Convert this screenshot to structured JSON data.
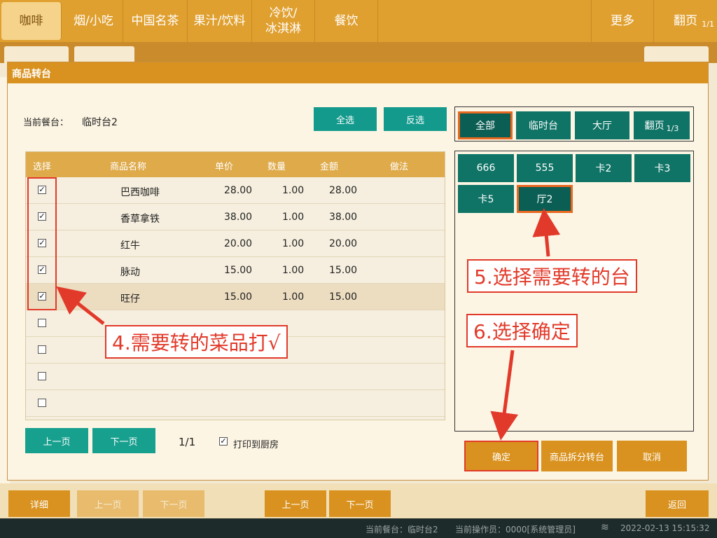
{
  "topbar": {
    "categories": [
      "咖啡",
      "烟/小吃",
      "中国名茶",
      "果汁/饮料",
      "冷饮/\n冰淇淋",
      "餐饮"
    ],
    "more": "更多",
    "page_label": "翻页",
    "page_num": "1/1"
  },
  "dialog": {
    "title": "商品转台",
    "current_table_label": "当前餐台：",
    "current_table_value": "临时台2",
    "select_all": "全选",
    "invert_select": "反选",
    "table": {
      "headers": [
        "选择",
        "商品名称",
        "单价",
        "数量",
        "金额",
        "做法"
      ],
      "rows": [
        {
          "checked": true,
          "name": "巴西咖啡",
          "price": "28.00",
          "qty": "1.00",
          "amount": "28.00",
          "method": ""
        },
        {
          "checked": true,
          "name": "香草拿铁",
          "price": "38.00",
          "qty": "1.00",
          "amount": "38.00",
          "method": ""
        },
        {
          "checked": true,
          "name": "红牛",
          "price": "20.00",
          "qty": "1.00",
          "amount": "20.00",
          "method": ""
        },
        {
          "checked": true,
          "name": "脉动",
          "price": "15.00",
          "qty": "1.00",
          "amount": "15.00",
          "method": ""
        },
        {
          "checked": true,
          "name": "旺仔",
          "price": "15.00",
          "qty": "1.00",
          "amount": "15.00",
          "method": ""
        },
        {
          "checked": false,
          "name": "",
          "price": "",
          "qty": "",
          "amount": "",
          "method": ""
        },
        {
          "checked": false,
          "name": "",
          "price": "",
          "qty": "",
          "amount": "",
          "method": ""
        },
        {
          "checked": false,
          "name": "",
          "price": "",
          "qty": "",
          "amount": "",
          "method": ""
        },
        {
          "checked": false,
          "name": "",
          "price": "",
          "qty": "",
          "amount": "",
          "method": ""
        }
      ]
    },
    "prev_page": "上一页",
    "next_page": "下一页",
    "page_indicator": "1/1",
    "print_kitchen_label": "打印到厨房",
    "print_kitchen_checked": true,
    "area_tabs": [
      "全部",
      "临时台",
      "大厅",
      "翻页"
    ],
    "area_page": "1/3",
    "tables": [
      "666",
      "555",
      "卡2",
      "卡3",
      "卡5",
      "厅2"
    ],
    "confirm": "确定",
    "split_transfer": "商品拆分转台",
    "cancel": "取消"
  },
  "annotations": {
    "step4": "4.需要转的菜品打√",
    "step5": "5.选择需要转的台",
    "step6": "6.选择确定"
  },
  "bottombar": {
    "detail": "详细",
    "prev": "上一页",
    "next": "下一页",
    "prev2": "上一页",
    "next2": "下一页",
    "back": "返回"
  },
  "status": {
    "current_table": "当前餐台：临时台2",
    "operator": "当前操作员：0000[系统管理员]",
    "datetime": "2022-02-13 15:15:32"
  },
  "colors": {
    "accent": "#e0a030",
    "teal": "#139a8d",
    "callout": "#e23a2a"
  }
}
